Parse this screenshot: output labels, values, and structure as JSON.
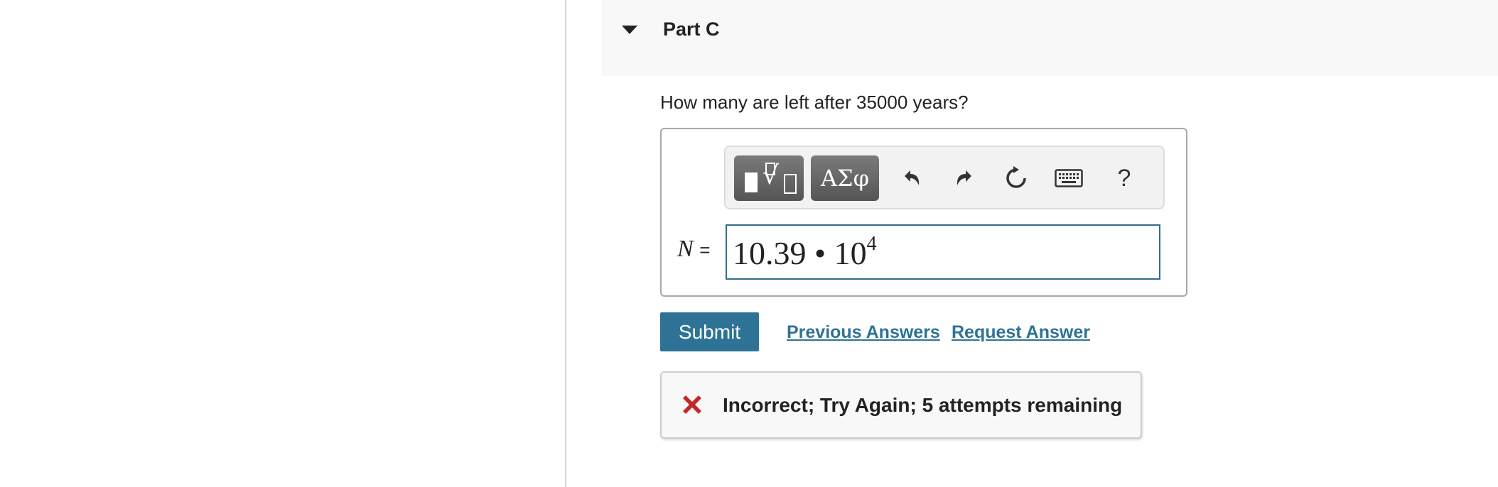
{
  "part": {
    "title": "Part C"
  },
  "question": {
    "text": "How many are left after 35000 years?"
  },
  "toolbar": {
    "templates_icon": "templates-icon",
    "symbols_label": "ΑΣφ",
    "undo_icon": "undo-icon",
    "redo_icon": "redo-icon",
    "reset_icon": "reset-icon",
    "keyboard_icon": "keyboard-icon",
    "help_label": "?"
  },
  "answer": {
    "variable": "N",
    "equals": "=",
    "mantissa": "10.39",
    "operator": "•",
    "base": "10",
    "exponent": "4"
  },
  "actions": {
    "submit_label": "Submit",
    "previous_answers_label": "Previous Answers",
    "request_answer_label": "Request Answer"
  },
  "feedback": {
    "text": "Incorrect; Try Again; 5 attempts remaining",
    "icon": "x-icon"
  },
  "colors": {
    "accent": "#2e7396",
    "error": "#c62828",
    "input_border": "#2f6d8a"
  }
}
